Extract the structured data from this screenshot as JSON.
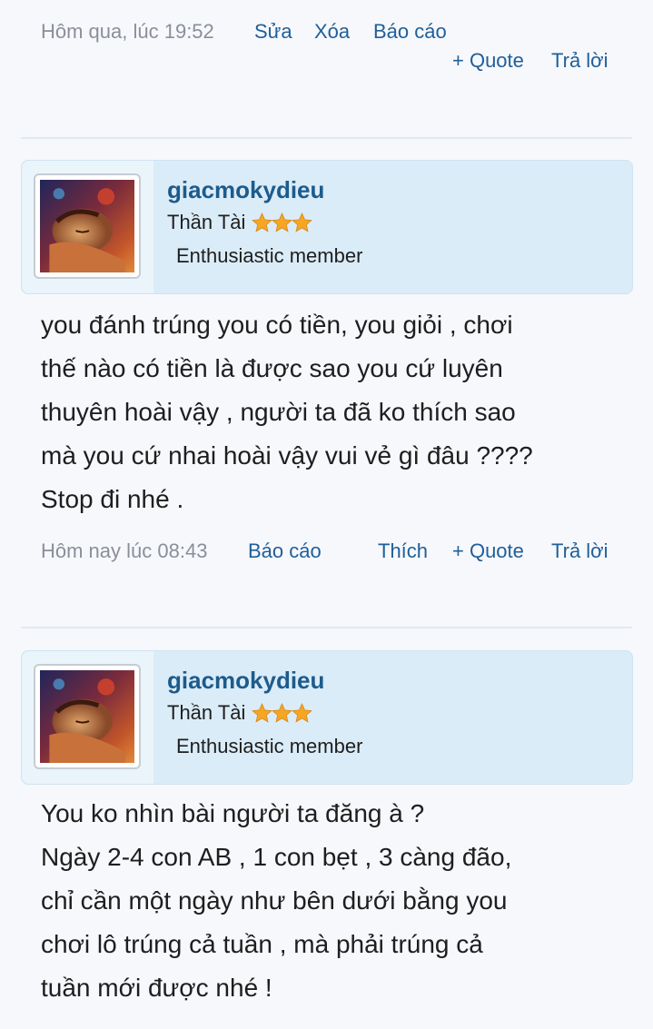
{
  "post_top": {
    "timestamp": "Hôm qua, lúc 19:52",
    "edit_label": "Sửa",
    "delete_label": "Xóa",
    "report_label": "Báo cáo",
    "quote_label": "+ Quote",
    "reply_label": "Trả lời"
  },
  "post_1": {
    "username": "giacmokydieu",
    "user_title": "Thần Tài",
    "stars": 3,
    "rank": "Enthusiastic member",
    "body_lines": [
      "you đánh trúng you có tiền, you giỏi , chơi",
      "thế nào có tiền là được sao you cứ luyên",
      "thuyên hoài vậy , người ta đã ko thích sao",
      "mà you cứ nhai hoài vậy vui vẻ gì đâu ????",
      "Stop đi nhé ."
    ],
    "timestamp": "Hôm nay lúc 08:43",
    "report_label": "Báo cáo",
    "like_label": "Thích",
    "quote_label": "+ Quote",
    "reply_label": "Trả lời"
  },
  "post_2": {
    "username": "giacmokydieu",
    "user_title": "Thần Tài",
    "stars": 3,
    "rank": "Enthusiastic member",
    "body_lines": [
      "You ko nhìn bài người ta đăng à ?",
      "Ngày 2-4 con AB , 1 con bẹt , 3 càng đão,",
      "chỉ cần một ngày như bên dưới bằng you",
      "chơi lô trúng cả tuần , mà phải trúng cả",
      "tuần mới được nhé !"
    ]
  },
  "colors": {
    "link": "#1f5f99",
    "username": "#1d5b8c",
    "header_bg": "#daecf8",
    "star": "#f5a623"
  },
  "icons": {
    "star": "star-icon",
    "avatar": "avatar-image"
  }
}
